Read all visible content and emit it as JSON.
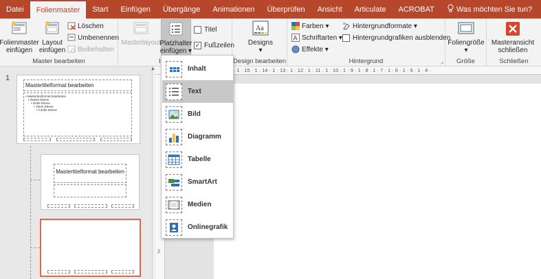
{
  "tabs": [
    "Datei",
    "Folienmaster",
    "Start",
    "Einfügen",
    "Übergänge",
    "Animationen",
    "Überprüfen",
    "Ansicht",
    "Articulate",
    "ACROBAT"
  ],
  "tell_me": "Was möchten Sie tun?",
  "colors": {
    "accent": "#b7472a",
    "selection": "#e0674a",
    "close_icon": "#d9452b"
  },
  "ribbon": {
    "master_edit": {
      "label": "Master bearbeiten",
      "insert_master_l1": "Folienmaster",
      "insert_master_l2": "einfügen",
      "insert_layout_l1": "Layout",
      "insert_layout_l2": "einfügen",
      "delete": "Löschen",
      "rename": "Umbenennen",
      "preserve": "Beibehalten"
    },
    "master_layout": {
      "label": "Masterlayout",
      "placeholder_l1": "Platzhalter",
      "placeholder_l2": "einfügen",
      "title_chk": "Titel",
      "footer_chk": "Fußzeilen",
      "group_short": "I"
    },
    "design": {
      "label": "Design bearbeiten",
      "designs": "Designs"
    },
    "background": {
      "label": "Hintergrund",
      "colors": "Farben",
      "fonts": "Schriftarten",
      "effects": "Effekte",
      "bg_formats": "Hintergrundformate",
      "hide_bg": "Hintergrundgrafiken ausblenden"
    },
    "size": {
      "label": "Größe",
      "slide_size": "Foliengröße"
    },
    "close": {
      "label": "Schließen",
      "close_l1": "Masteransicht",
      "close_l2": "schließen"
    }
  },
  "thumbs": {
    "num": "1",
    "master_title": "Mastertitelformat bearbeiten",
    "master_text": "Mastertextformat bearbeiten",
    "level2": "Zweite Ebene",
    "level3": "Dritte Ebene",
    "level4": "Vierte Ebene",
    "level5": "Fünfte Ebene",
    "layout_title": "Mastertitelformat bearbeiten"
  },
  "ruler": {
    "h": "· 1 · 16 · 1 · 15 · 1 · 14 · 1 · 13 · 1 · 12 · 1 · 11 · 1 · 10 · 1 · 9 · 1 · 8 · 1 · 7 · 1 · 6 · 1 · 5 · 1 · 4 ·",
    "v_tick": "2"
  },
  "menu": [
    {
      "label": "Inhalt",
      "icon": "content-placeholder-icon"
    },
    {
      "label": "Text",
      "icon": "text-placeholder-icon"
    },
    {
      "label": "Bild",
      "icon": "picture-placeholder-icon"
    },
    {
      "label": "Diagramm",
      "icon": "chart-placeholder-icon"
    },
    {
      "label": "Tabelle",
      "icon": "table-placeholder-icon"
    },
    {
      "label": "SmartArt",
      "icon": "smartart-placeholder-icon"
    },
    {
      "label": "Medien",
      "icon": "media-placeholder-icon"
    },
    {
      "label": "Onlinegrafik",
      "icon": "online-picture-placeholder-icon"
    }
  ]
}
